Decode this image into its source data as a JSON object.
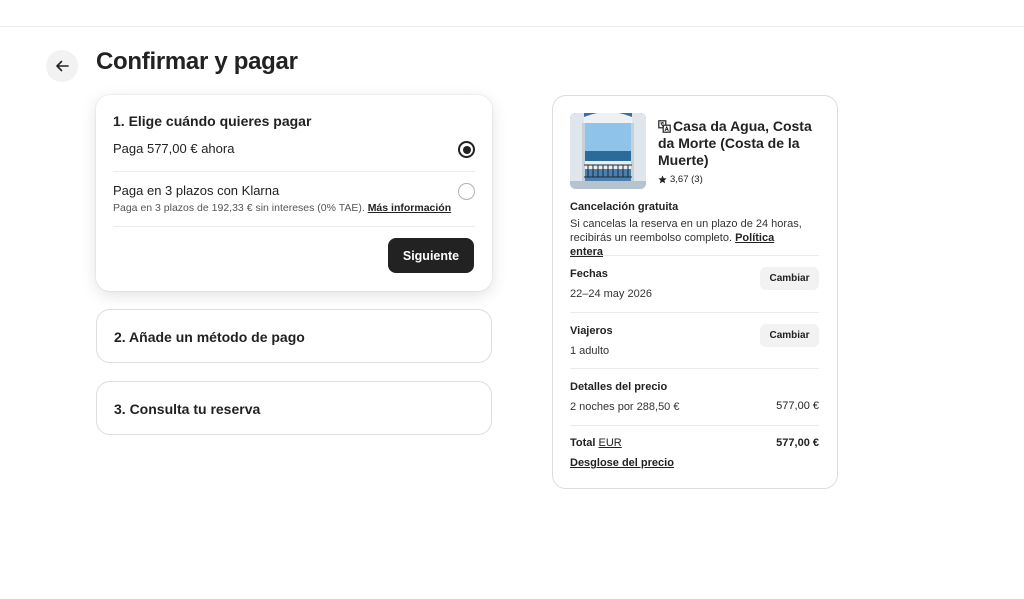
{
  "page": {
    "title": "Confirmar y pagar"
  },
  "steps": {
    "step1": {
      "title": "1. Elige cuándo quieres pagar",
      "option_now": "Paga 577,00 € ahora",
      "option_klarna": "Paga en 3 plazos con Klarna",
      "klarna_sub": "Paga en 3 plazos de 192,33 € sin intereses (0% TAE).",
      "klarna_link": "Más información",
      "next_label": "Siguiente"
    },
    "step2": {
      "title": "2. Añade un método de pago"
    },
    "step3": {
      "title": "3. Consulta tu reserva"
    }
  },
  "summary": {
    "property": {
      "name": "Casa da Agua, Costa da Morte (Costa de la Muerte)",
      "rating": "3,67 (3)"
    },
    "cancellation": {
      "title": "Cancelación gratuita",
      "text": "Si cancelas la reserva en un plazo de 24 horas, recibirás un reembolso completo.",
      "link": "Política entera"
    },
    "dates": {
      "label": "Fechas",
      "value": "22–24 may 2026",
      "change_label": "Cambiar"
    },
    "travelers": {
      "label": "Viajeros",
      "value": "1 adulto",
      "change_label": "Cambiar"
    },
    "price": {
      "label": "Detalles del precio",
      "line": "2 noches por 288,50 €",
      "line_amount": "577,00 €",
      "total_label": "Total",
      "currency": "EUR",
      "total_amount": "577,00 €",
      "breakdown_link": "Desglose del precio"
    }
  },
  "colors": {
    "primary_dark": "#222222",
    "border": "#dddddd",
    "muted_bg": "#f2f2f2"
  }
}
